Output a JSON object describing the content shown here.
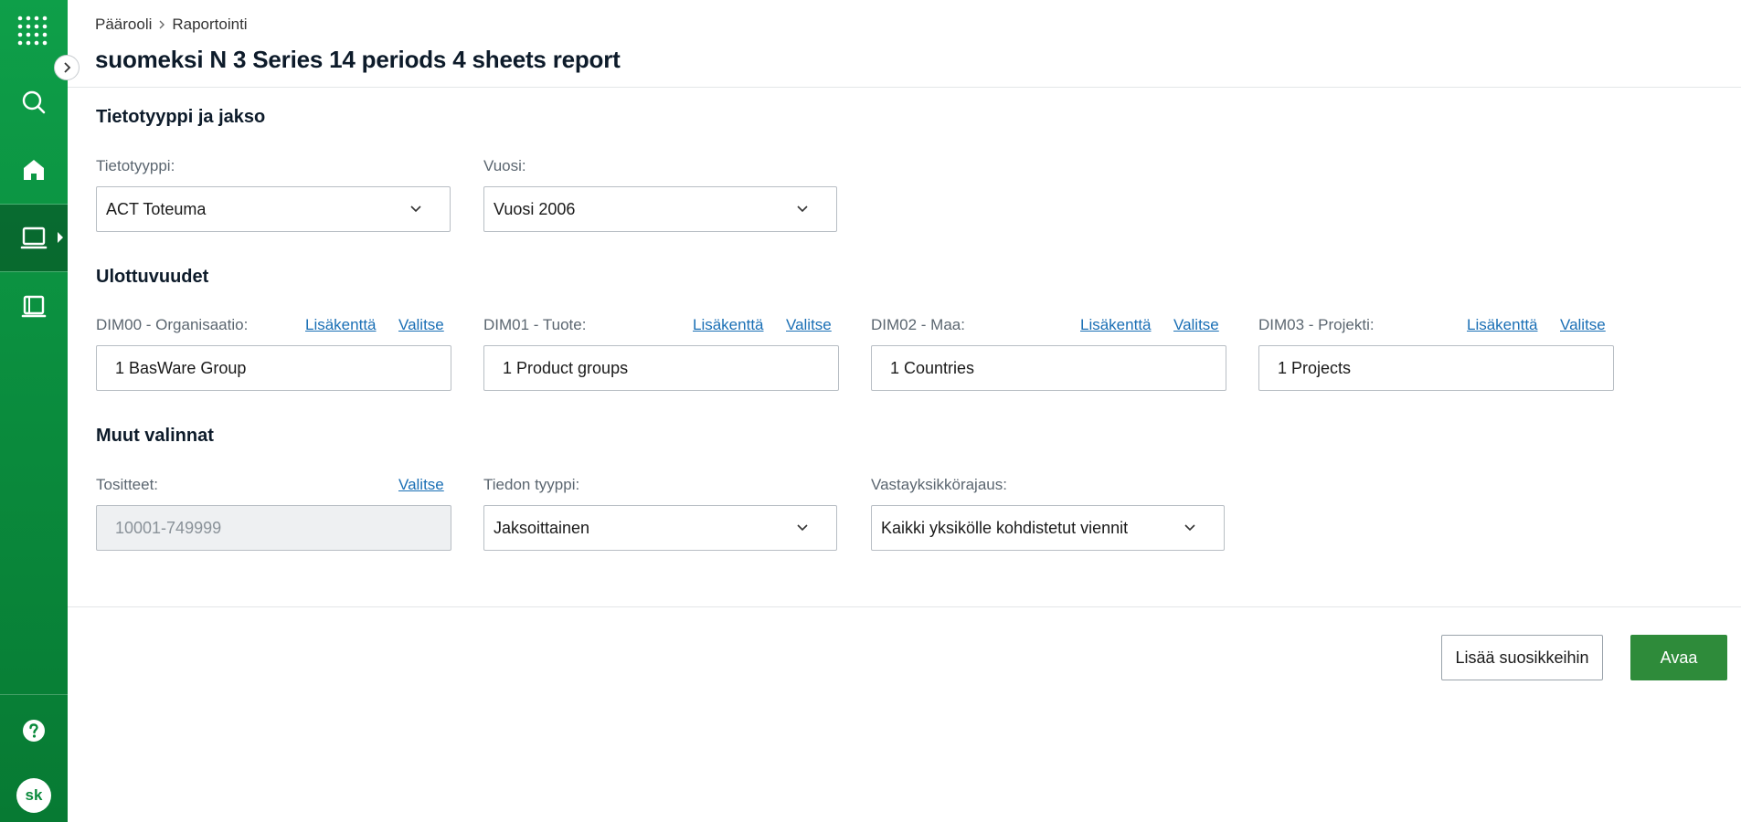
{
  "sidebar": {
    "avatar_initials": "sk",
    "accent_color": "#0a8a3c",
    "icons": [
      "apps-grid-icon",
      "search-icon",
      "home-icon",
      "reports-icon",
      "document-icon",
      "help-icon"
    ]
  },
  "breadcrumb": {
    "root": "Päärooli",
    "current": "Raportointi"
  },
  "page": {
    "title": "suomeksi N 3 Series 14 periods 4 sheets report"
  },
  "section1": {
    "title": "Tietotyyppi ja jakso",
    "datatype_label": "Tietotyyppi:",
    "datatype_value": "ACT Toteuma",
    "year_label": "Vuosi:",
    "year_value": "Vuosi 2006"
  },
  "section2": {
    "title": "Ulottuvuudet",
    "link_extra": "Lisäkenttä",
    "link_select": "Valitse",
    "dims": [
      {
        "label": "DIM00 - Organisaatio:",
        "value": "1 BasWare Group"
      },
      {
        "label": "DIM01 - Tuote:",
        "value": "1 Product groups"
      },
      {
        "label": "DIM02 - Maa:",
        "value": "1 Countries"
      },
      {
        "label": "DIM03 - Projekti:",
        "value": "1 Projects"
      }
    ]
  },
  "section3": {
    "title": "Muut valinnat",
    "vouchers_label": "Tositteet:",
    "vouchers_link": "Valitse",
    "vouchers_placeholder": "10001-749999",
    "datatype2_label": "Tiedon tyyppi:",
    "datatype2_value": "Jaksoittainen",
    "cc_label": "Vastayksikkörajaus:",
    "cc_value": "Kaikki yksikölle kohdistetut viennit"
  },
  "actions": {
    "favorite_label": "Lisää suosikkeihin",
    "open_label": "Avaa"
  }
}
